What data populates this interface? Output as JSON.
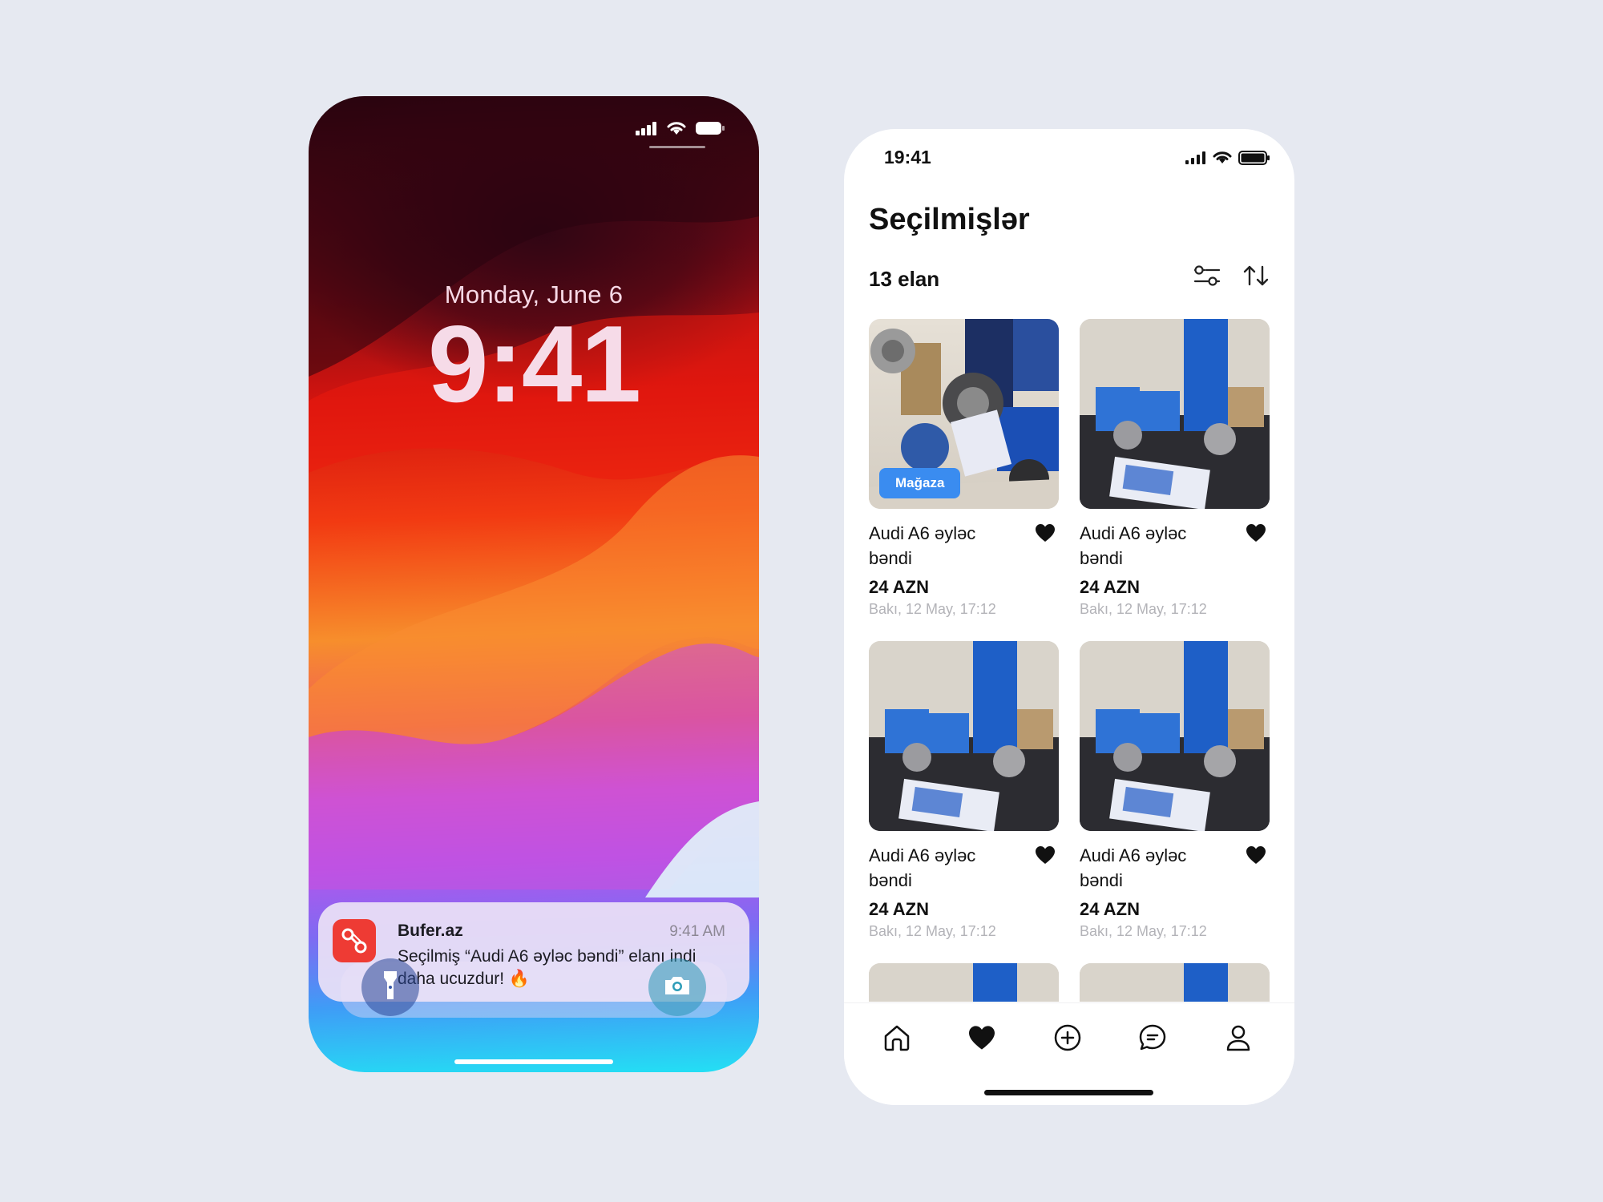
{
  "lock_screen": {
    "date": "Monday, June 6",
    "time": "9:41",
    "notification": {
      "app_name": "Bufer.az",
      "time": "9:41 AM",
      "message": "Seçilmiş “Audi A6 əyləc bəndi” elanı indi daha ucuzdur! 🔥",
      "icon": "link-chain-icon"
    },
    "buttons": {
      "left_icon": "flashlight-icon",
      "right_icon": "camera-icon"
    }
  },
  "app": {
    "status_time": "19:41",
    "title": "Seçilmişlər",
    "count_label": "13 elan",
    "toolbar": {
      "filter_icon": "filter-sliders-icon",
      "sort_icon": "sort-arrows-icon"
    },
    "listings": [
      {
        "title": "Audi A6 əyləc bəndi",
        "price": "24 AZN",
        "meta": "Bakı, 12 May, 17:12",
        "badge": "Mağaza",
        "favorited": true
      },
      {
        "title": "Audi A6 əyləc bəndi",
        "price": "24 AZN",
        "meta": "Bakı, 12 May, 17:12",
        "badge": "",
        "favorited": true
      },
      {
        "title": "Audi A6 əyləc bəndi",
        "price": "24 AZN",
        "meta": "Bakı, 12 May, 17:12",
        "badge": "",
        "favorited": true
      },
      {
        "title": "Audi A6 əyləc bəndi",
        "price": "24 AZN",
        "meta": "Bakı, 12 May, 17:12",
        "badge": "",
        "favorited": true
      }
    ],
    "tabbar": [
      "home-icon",
      "heart-icon",
      "plus-circle-icon",
      "chat-icon",
      "profile-icon"
    ],
    "colors": {
      "accent_blue": "#3a8cf0",
      "notif_icon_red": "#ee3b34",
      "text_primary": "#111111",
      "text_muted": "#b3b3b8"
    }
  }
}
